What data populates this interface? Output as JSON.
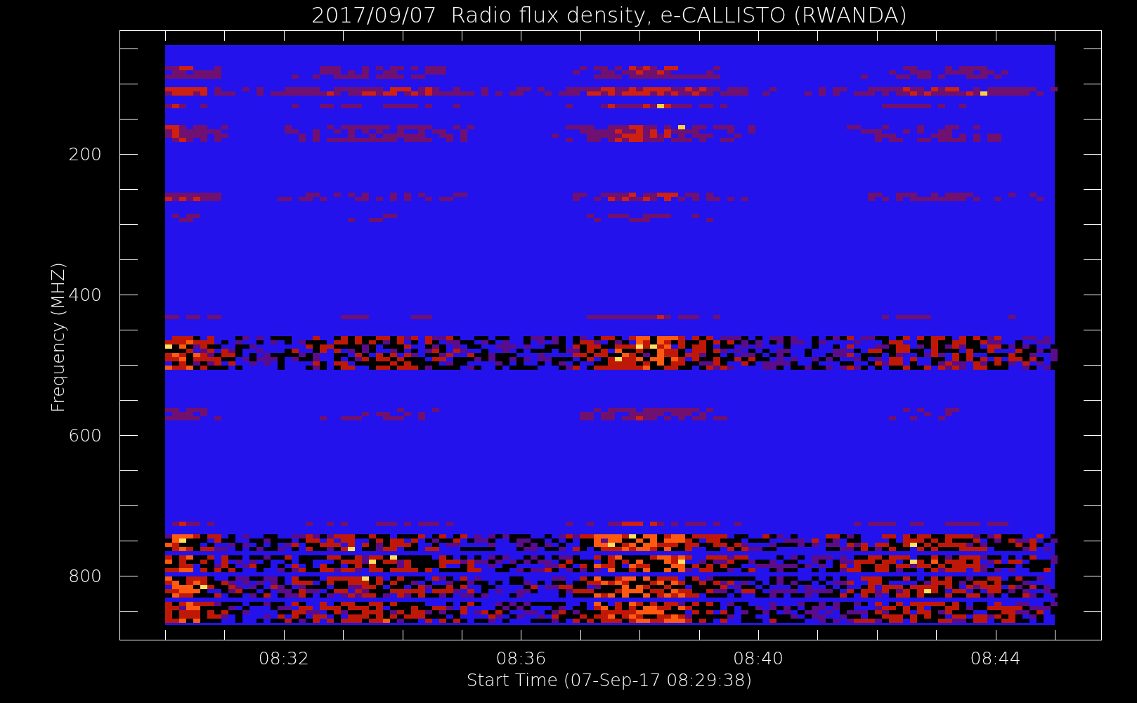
{
  "title": "2017/09/07  Radio flux density, e-CALLISTO (RWANDA)",
  "y_axis": {
    "label": "Frequency (MHZ)",
    "ticks": [
      "200",
      "400",
      "600",
      "800"
    ]
  },
  "x_axis": {
    "label": "Start Time (07-Sep-17 08:29:38)",
    "ticks": [
      "08:32",
      "08:36",
      "08:40",
      "08:44"
    ]
  }
}
